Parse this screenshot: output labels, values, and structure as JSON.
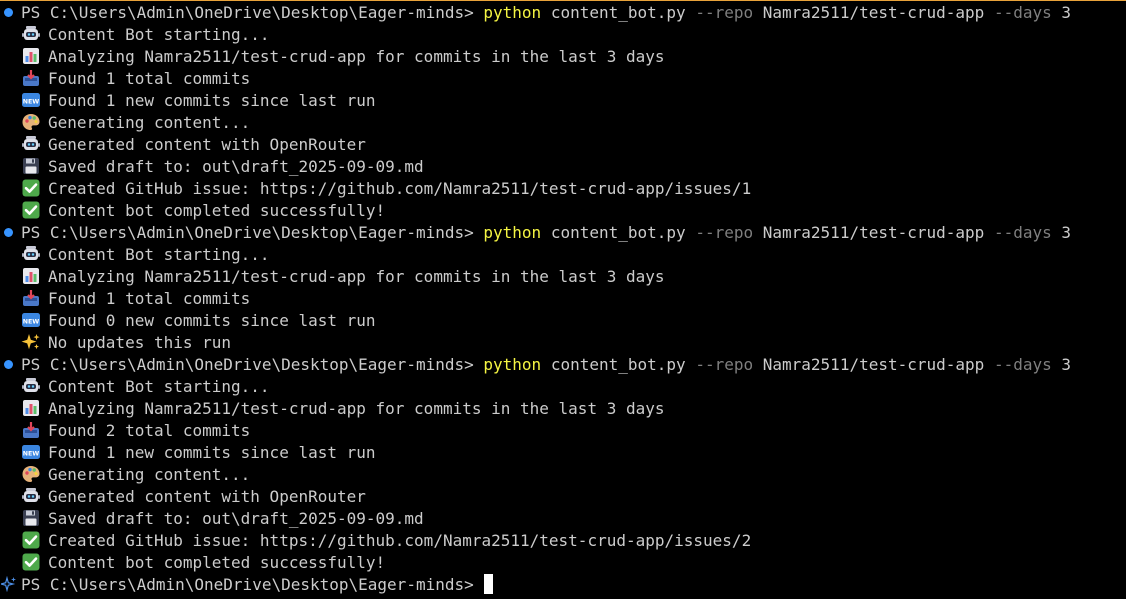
{
  "prompt": {
    "path": "PS C:\\Users\\Admin\\OneDrive\\Desktop\\Eager-minds> "
  },
  "command": {
    "exe": "python",
    "script": "content_bot.py",
    "repo_flag": "--repo",
    "repo_value": "Namra2511/test-crud-app",
    "days_flag": "--days",
    "days_value": "3"
  },
  "runs": [
    {
      "lines": [
        {
          "icon": "robot-icon",
          "text": "Content Bot starting..."
        },
        {
          "icon": "bar-chart-icon",
          "text": "Analyzing Namra2511/test-crud-app for commits in the last 3 days"
        },
        {
          "icon": "inbox-tray-icon",
          "text": "Found 1 total commits"
        },
        {
          "icon": "new-badge-icon",
          "text": "Found 1 new commits since last run"
        },
        {
          "icon": "palette-icon",
          "text": "Generating content..."
        },
        {
          "icon": "robot-icon",
          "text": "Generated content with OpenRouter"
        },
        {
          "icon": "floppy-disk-icon",
          "text": "Saved draft to: out\\draft_2025-09-09.md"
        },
        {
          "icon": "check-mark-icon",
          "text": "Created GitHub issue: https://github.com/Namra2511/test-crud-app/issues/1"
        },
        {
          "icon": "check-mark-icon",
          "text": "Content bot completed successfully!"
        }
      ]
    },
    {
      "lines": [
        {
          "icon": "robot-icon",
          "text": "Content Bot starting..."
        },
        {
          "icon": "bar-chart-icon",
          "text": "Analyzing Namra2511/test-crud-app for commits in the last 3 days"
        },
        {
          "icon": "inbox-tray-icon",
          "text": "Found 1 total commits"
        },
        {
          "icon": "new-badge-icon",
          "text": "Found 0 new commits since last run"
        },
        {
          "icon": "sparkles-icon",
          "text": "No updates this run"
        }
      ]
    },
    {
      "lines": [
        {
          "icon": "robot-icon",
          "text": "Content Bot starting..."
        },
        {
          "icon": "bar-chart-icon",
          "text": "Analyzing Namra2511/test-crud-app for commits in the last 3 days"
        },
        {
          "icon": "inbox-tray-icon",
          "text": "Found 2 total commits"
        },
        {
          "icon": "new-badge-icon",
          "text": "Found 1 new commits since last run"
        },
        {
          "icon": "palette-icon",
          "text": "Generating content..."
        },
        {
          "icon": "robot-icon",
          "text": "Generated content with OpenRouter"
        },
        {
          "icon": "floppy-disk-icon",
          "text": "Saved draft to: out\\draft_2025-09-09.md"
        },
        {
          "icon": "check-mark-icon",
          "text": "Created GitHub issue: https://github.com/Namra2511/test-crud-app/issues/2"
        },
        {
          "icon": "check-mark-icon",
          "text": "Content bot completed successfully!"
        }
      ]
    }
  ],
  "colors": {
    "background": "#000000",
    "text": "#cccccc",
    "command": "#f5f543",
    "flag": "#7f7f7f",
    "prompt_dot": "#3794ff",
    "accent_border": "#e8a23a"
  }
}
